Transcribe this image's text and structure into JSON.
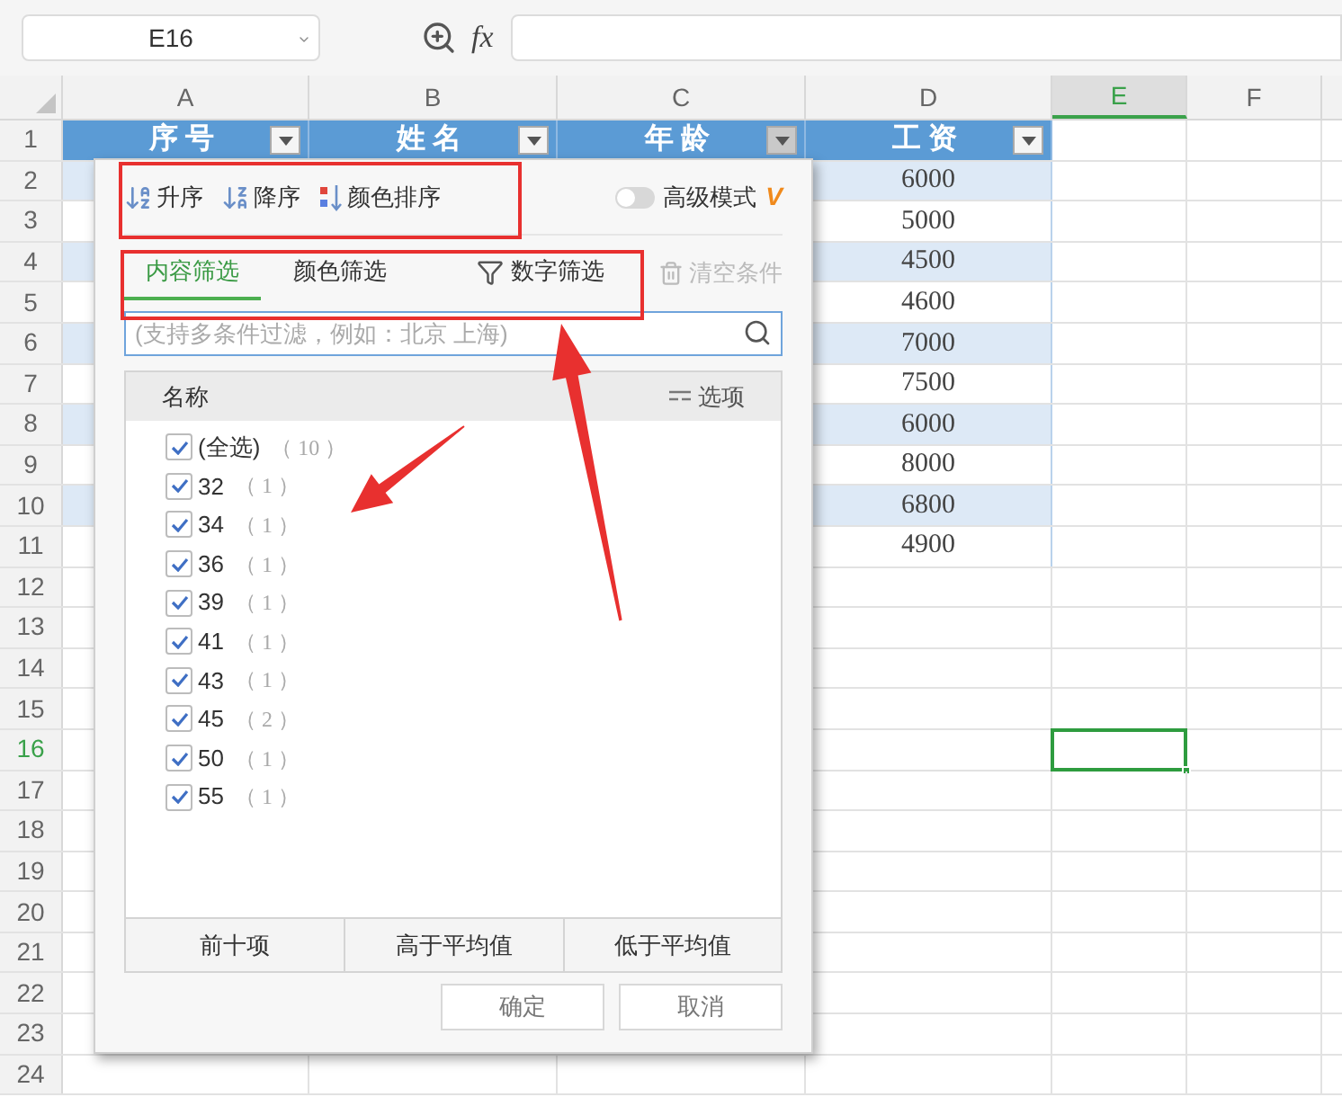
{
  "name_box": {
    "value": "E16"
  },
  "formula_bar": {
    "fx_label": "fx"
  },
  "sheet": {
    "columns": [
      {
        "label": "A",
        "selected": false
      },
      {
        "label": "B",
        "selected": false
      },
      {
        "label": "C",
        "selected": false
      },
      {
        "label": "D",
        "selected": false
      },
      {
        "label": "E",
        "selected": true
      },
      {
        "label": "F",
        "selected": false
      }
    ],
    "rows": [
      {
        "label": "1",
        "selected": false
      },
      {
        "label": "2",
        "selected": false
      },
      {
        "label": "3",
        "selected": false
      },
      {
        "label": "4",
        "selected": false
      },
      {
        "label": "5",
        "selected": false
      },
      {
        "label": "6",
        "selected": false
      },
      {
        "label": "7",
        "selected": false
      },
      {
        "label": "8",
        "selected": false
      },
      {
        "label": "9",
        "selected": false
      },
      {
        "label": "10",
        "selected": false
      },
      {
        "label": "11",
        "selected": false
      },
      {
        "label": "12",
        "selected": false
      },
      {
        "label": "13",
        "selected": false
      },
      {
        "label": "14",
        "selected": false
      },
      {
        "label": "15",
        "selected": false
      },
      {
        "label": "16",
        "selected": true
      },
      {
        "label": "17",
        "selected": false
      },
      {
        "label": "18",
        "selected": false
      },
      {
        "label": "19",
        "selected": false
      },
      {
        "label": "20",
        "selected": false
      },
      {
        "label": "21",
        "selected": false
      },
      {
        "label": "22",
        "selected": false
      },
      {
        "label": "23",
        "selected": false
      },
      {
        "label": "24",
        "selected": false
      }
    ],
    "header_cells": [
      {
        "label": "序号",
        "filter_open": false
      },
      {
        "label": "姓名",
        "filter_open": false
      },
      {
        "label": "年龄",
        "filter_open": true
      },
      {
        "label": "工资",
        "filter_open": false
      }
    ],
    "salary_values": [
      "6000",
      "5000",
      "4500",
      "4600",
      "7000",
      "7500",
      "6000",
      "8000",
      "6800",
      "4900"
    ]
  },
  "filter_popup": {
    "sort_buttons": [
      {
        "label": "升序",
        "kind": "asc"
      },
      {
        "label": "降序",
        "kind": "desc"
      },
      {
        "label": "颜色排序",
        "kind": "color"
      }
    ],
    "advanced_mode": {
      "label": "高级模式",
      "on": false,
      "badge": "V"
    },
    "tabs": [
      {
        "label": "内容筛选",
        "selected": true,
        "kind": "plain"
      },
      {
        "label": "颜色筛选",
        "selected": false,
        "kind": "plain"
      },
      {
        "label": "数字筛选",
        "selected": false,
        "kind": "number"
      }
    ],
    "clear_button": {
      "label": "清空条件",
      "disabled": true
    },
    "search": {
      "placeholder": "(支持多条件过滤，例如：北京 上海)"
    },
    "list": {
      "header": "名称",
      "options_label": "选项",
      "items": [
        {
          "label": "(全选)",
          "count": "（ 10 ）",
          "checked": true
        },
        {
          "label": "32",
          "count": "（ 1 ）",
          "checked": true
        },
        {
          "label": "34",
          "count": "（ 1 ）",
          "checked": true
        },
        {
          "label": "36",
          "count": "（ 1 ）",
          "checked": true
        },
        {
          "label": "39",
          "count": "（ 1 ）",
          "checked": true
        },
        {
          "label": "41",
          "count": "（ 1 ）",
          "checked": true
        },
        {
          "label": "43",
          "count": "（ 1 ）",
          "checked": true
        },
        {
          "label": "45",
          "count": "（ 2 ）",
          "checked": true
        },
        {
          "label": "50",
          "count": "（ 1 ）",
          "checked": true
        },
        {
          "label": "55",
          "count": "（ 1 ）",
          "checked": true
        }
      ]
    },
    "quick_buttons": [
      "前十项",
      "高于平均值",
      "低于平均值"
    ],
    "buttons": [
      "确定",
      "取消"
    ]
  }
}
